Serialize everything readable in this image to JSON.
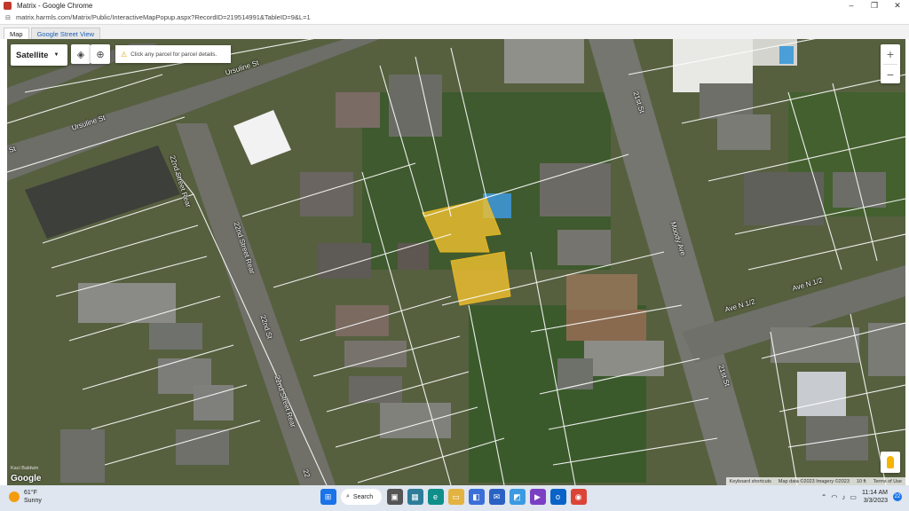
{
  "window": {
    "title": "Matrix - Google Chrome",
    "minimize": "–",
    "restore": "❐",
    "close": "✕"
  },
  "browser": {
    "url": "matrix.harmls.com/Matrix/Public/InteractiveMapPopup.aspx?RecordID=219514991&TableID=9&L=1"
  },
  "tabs": [
    {
      "label": "Map",
      "active": true
    },
    {
      "label": "Google Street View",
      "active": false
    }
  ],
  "map": {
    "map_type": "Satellite",
    "notice": "Click any parcel for parcel details.",
    "zoom_in": "+",
    "zoom_out": "−",
    "google": "Google",
    "small_text": "Kaci Baldwin",
    "attribution": {
      "shortcuts": "Keyboard shortcuts",
      "data": "Map data ©2023 Imagery ©2023",
      "scale": "10 ft",
      "terms": "Terms of Use"
    },
    "streets": {
      "ursuline_1": "Ursuline St",
      "ursuline_2": "Ursuline St",
      "st_left": "St",
      "twentysecond_rear_1": "22nd Street Rear",
      "twentysecond_rear_2": "22nd Street Rear",
      "twentysecond_rear_3": "22nd Street Rear",
      "twentysecond": "22nd St",
      "twentyfirst_1": "21st St",
      "twentyfirst_2": "21st St",
      "moody": "Moody Ave",
      "ave_n_half_1": "Ave N 1/2",
      "ave_n_half_2": "Ave N 1/2",
      "bottom_cut": "22"
    },
    "highlight_color": "#f2c230"
  },
  "taskbar": {
    "weather_temp": "61°F",
    "weather_desc": "Sunny",
    "search": "Search",
    "time": "11:14 AM",
    "date": "3/3/2023",
    "notif_count": "22"
  }
}
